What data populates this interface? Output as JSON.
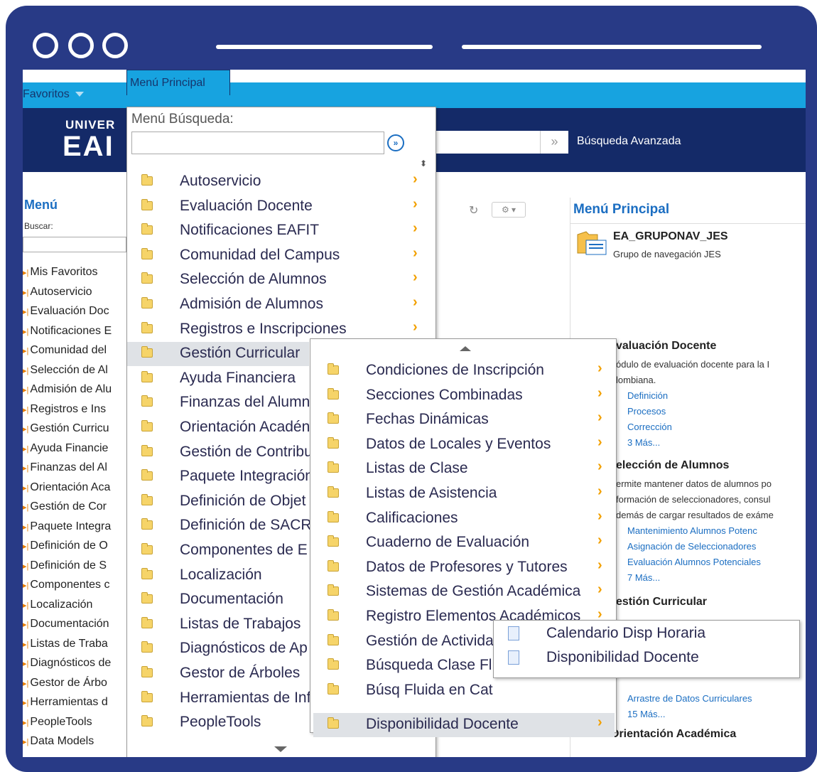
{
  "nav": {
    "favorites": "Favoritos",
    "main_menu_tab": "Menú Principal"
  },
  "banner": {
    "logo_line1": "UNIVER",
    "logo_line2": "EAI",
    "advanced_search": "Búsqueda Avanzada",
    "go": "»"
  },
  "left_menu": {
    "title": "Menú",
    "search_label": "Buscar:",
    "items": [
      "Mis Favoritos",
      "Autoservicio",
      "Evaluación Doc",
      "Notificaciones E",
      "Comunidad del",
      "Selección de Al",
      "Admisión de Alu",
      "Registros e Ins",
      "Gestión Curricu",
      "Ayuda Financie",
      "Finanzas del Al",
      "Orientación Aca",
      "Gestión de Cor",
      "Paquete Integra",
      "Definición de O",
      "Definición de S",
      "Componentes c",
      "Localización",
      "Documentación",
      "Listas de Traba",
      "Diagnósticos de",
      "Gestor de Árbo",
      "Herramientas d",
      "PeopleTools",
      "Data Models"
    ]
  },
  "dropdown_main": {
    "header": "Menú Búsqueda:",
    "items": [
      "Autoservicio",
      "Evaluación Docente",
      "Notificaciones EAFIT",
      "Comunidad del Campus",
      "Selección de Alumnos",
      "Admisión de Alumnos",
      "Registros e Inscripciones",
      "Gestión Curricular",
      "Ayuda Financiera",
      "Finanzas del Alumn",
      "Orientación Acadén",
      "Gestión de Contribu",
      "Paquete Integración",
      "Definición de Objet",
      "Definición de SACR",
      "Componentes de E",
      "Localización",
      "Documentación",
      "Listas de Trabajos",
      "Diagnósticos de Ap",
      "Gestor de Árboles",
      "Herramientas de Inf",
      "PeopleTools"
    ],
    "highlighted": "Gestión Curricular"
  },
  "dropdown_sub": {
    "items": [
      "Condiciones de Inscripción",
      "Secciones Combinadas",
      "Fechas Dinámicas",
      "Datos de Locales y Eventos",
      "Listas de Clase",
      "Listas de Asistencia",
      "Calificaciones",
      "Cuaderno de Evaluación",
      "Datos de Profesores y Tutores",
      "Sistemas de Gestión Académica",
      "Registro Elementos Académicos",
      "Gestión de Activida",
      "Búsqueda Clase Fl",
      "Búsq Fluida en Cat",
      "Disponibilidad Docente"
    ],
    "highlighted": "Disponibilidad Docente"
  },
  "dropdown_leaf": {
    "items": [
      "Calendario Disp Horaria",
      "Disponibilidad Docente"
    ]
  },
  "right_panel": {
    "title": "Menú Principal",
    "group_title": "EA_GRUPONAV_JES",
    "group_desc": "Grupo de navegación JES",
    "sections": [
      {
        "title": "valuación Docente",
        "desc": [
          "ódulo de evaluación docente para la I",
          "lombiana."
        ],
        "links": [
          "Definición",
          "Procesos",
          "Corrección",
          "3 Más..."
        ]
      },
      {
        "title": "elección de Alumnos",
        "desc": [
          "ermite mantener datos de alumnos po",
          "formación de seleccionadores, consul",
          "demás de cargar resultados de exáme"
        ],
        "links": [
          "Mantenimiento Alumnos Potenc",
          "Asignación de Seleccionadores",
          "Evaluación Alumnos Potenciales",
          "7 Más..."
        ]
      },
      {
        "title": "estión Curricular",
        "desc": [],
        "links": [
          "Arrastre de Datos Curriculares",
          "15 Más..."
        ]
      },
      {
        "title": "Orientación Académica",
        "desc": [],
        "links": []
      }
    ]
  },
  "colors": {
    "frame": "#283a86",
    "topbar": "#17a3e0",
    "banner": "#142a68",
    "link": "#1b6ec2",
    "chevron": "#f2a000",
    "highlight": "#dfe2e6"
  }
}
